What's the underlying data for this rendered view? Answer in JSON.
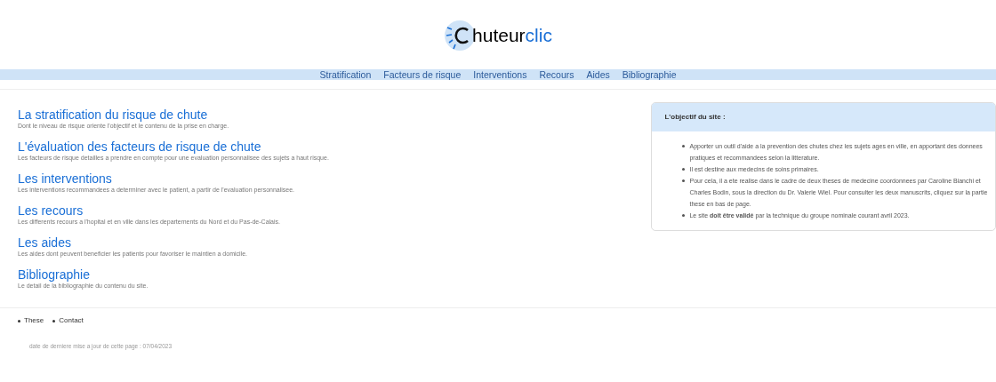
{
  "logo": {
    "text": "huteur",
    "accent": "clic"
  },
  "nav": [
    {
      "label": "Stratification"
    },
    {
      "label": "Facteurs de risque"
    },
    {
      "label": "Interventions"
    },
    {
      "label": "Recours"
    },
    {
      "label": "Aides"
    },
    {
      "label": "Bibliographie"
    }
  ],
  "sections": [
    {
      "title": "La stratification du risque de chute",
      "description": "Dont le niveau de risque oriente l'objectif et le contenu de la prise en charge."
    },
    {
      "title": "L'évaluation des facteurs de risque de chute",
      "description": "Les facteurs de risque detailles a prendre en compte pour une evaluation personnalisee des sujets a haut risque."
    },
    {
      "title": "Les interventions",
      "description": "Les interventions recommandees a determiner avec le patient, a partir de l'evaluation personnalisee."
    },
    {
      "title": "Les recours",
      "description": "Les differents recours a l'hopital et en ville dans les departements du Nord et du Pas-de-Calais."
    },
    {
      "title": "Les aides",
      "description": "Les aides dont peuvent beneficier les patients pour favoriser le maintien a domicile."
    },
    {
      "title": "Bibliographie",
      "description": "Le detail de la bibliographie du contenu du site."
    }
  ],
  "objective": {
    "title": "L'objectif du site :",
    "items": [
      "Apporter un outil d'aide a la prevention des chutes chez les sujets ages en ville, en apportant des donnees pratiques et recommandees selon la litterature.",
      "Il est destine aux medecins de soins primaires.",
      "Pour cela, il a ete realise dans le cadre de deux theses de medecine coordonnees par Caroline Bianchi et Charles Bodin, sous la direction du Dr. Valerie Wiel. Pour consulter les deux manuscrits, cliquez sur la partie these en bas de page.",
      "Le site **doit être validé** par la technique du groupe nominale courant avril 2023."
    ]
  },
  "footer": {
    "links": [
      "These",
      "Contact"
    ],
    "updated": "date de derniere mise a jour de cette page : 07/04/2023"
  }
}
